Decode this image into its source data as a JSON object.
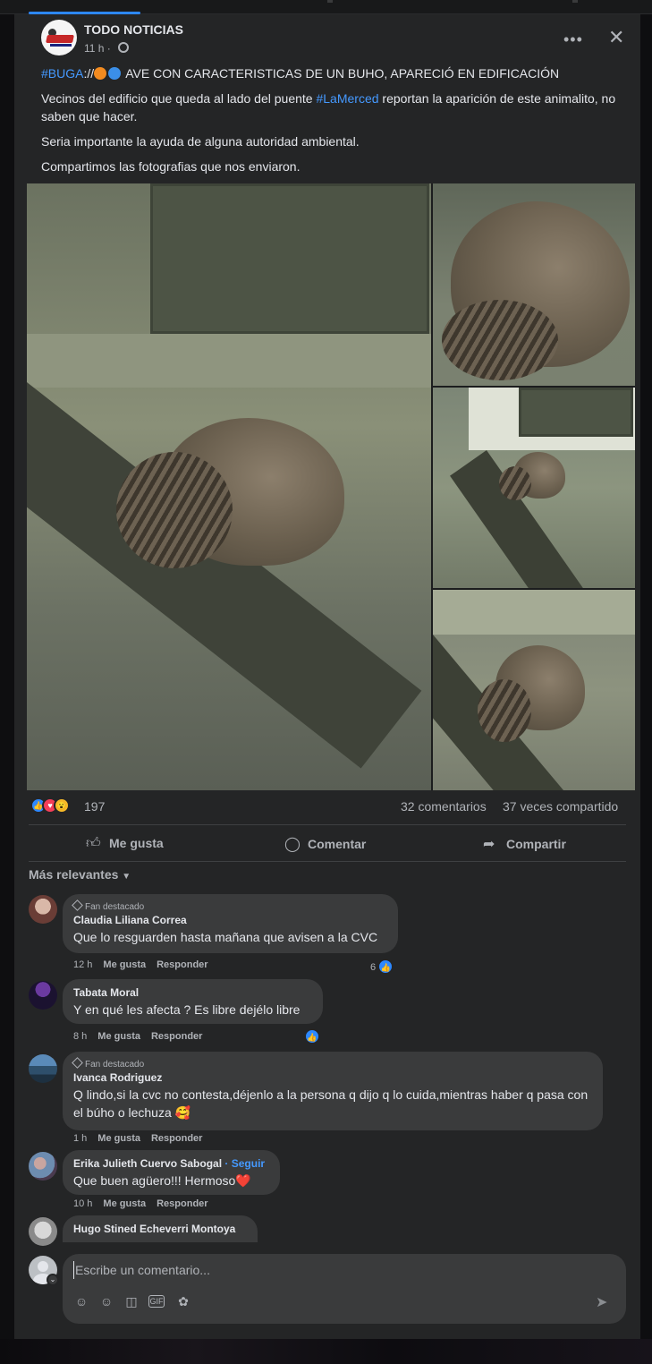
{
  "post": {
    "page_name": "TODO NOTICIAS",
    "time": "11 h ·",
    "hashtag_city": "#BUGA",
    "headline_sep": "://",
    "headline_text": " AVE CON CARACTERISTICAS DE UN BUHO, APARECIÓ EN EDIFICACIÓN",
    "line2_pre": "Vecinos del edificio que queda al lado del puente ",
    "line2_tag": "#LaMerced",
    "line2_post": " reportan la aparición de este animalito, no saben que hacer.",
    "line3": "Seria importante la ayuda de alguna autoridad ambiental.",
    "line4": "Compartimos las fotografias que nos enviaron.",
    "more_label": "•••",
    "close_label": "✕"
  },
  "stats": {
    "reactions": "197",
    "comments": "32 comentarios",
    "shares": "37 veces compartido"
  },
  "actions": {
    "like": "Me gusta",
    "comment": "Comentar",
    "share": "Compartir"
  },
  "sort_label": "Más relevantes",
  "comments": [
    {
      "badge": "Fan destacado",
      "name": "Claudia Liliana Correa",
      "text": "Que lo resguarden hasta mañana que avisen a la CVC",
      "time": "12 h",
      "like": "Me gusta",
      "reply": "Responder",
      "likes": "6"
    },
    {
      "name": "Tabata Moral",
      "text": "Y en qué les afecta ? Es libre dejélo libre",
      "time": "8 h",
      "like": "Me gusta",
      "reply": "Responder"
    },
    {
      "badge": "Fan destacado",
      "name": "Ivanca Rodriguez",
      "text": "Q lindo,si la cvc no contesta,déjenlo a la persona q dijo q lo cuida,mientras haber q pasa con el búho o lechuza 🥰",
      "time": "1 h",
      "like": "Me gusta",
      "reply": "Responder"
    },
    {
      "name": "Erika Julieth Cuervo Sabogal",
      "follow": "· Seguir",
      "text": "Que buen agüero!!! Hermoso❤️",
      "time": "10 h",
      "like": "Me gusta",
      "reply": "Responder"
    },
    {
      "name": "Hugo Stined Echeverri Montoya"
    }
  ],
  "composer": {
    "placeholder": "Escribe un comentario..."
  },
  "icons": {
    "like": "thumbs-up-icon",
    "comment": "speech-bubble-icon",
    "share": "share-arrow-icon",
    "send": "send-icon"
  },
  "colors": {
    "accent": "#2d88ff",
    "card_bg": "#242526",
    "bubble_bg": "#3a3b3c",
    "love": "#f33e58",
    "wow": "#f7b928"
  }
}
